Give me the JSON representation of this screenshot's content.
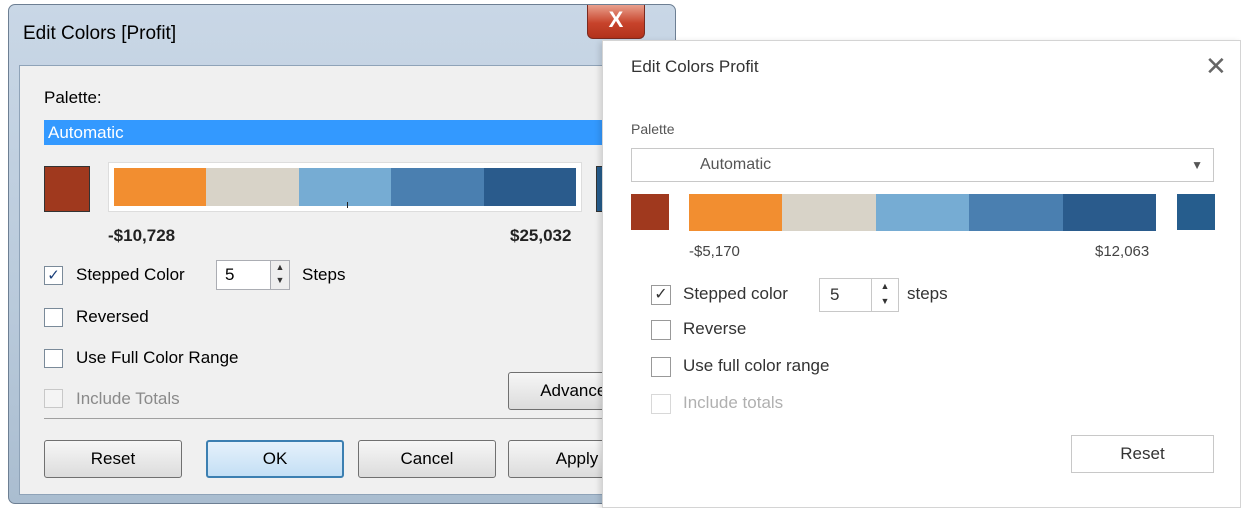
{
  "old_dialog": {
    "title": "Edit Colors [Profit]",
    "close_glyph": "X",
    "palette_label": "Palette:",
    "palette_value": "Automatic",
    "min_value": "-$10,728",
    "max_value": "$25,032",
    "stepped_label": "Stepped Color",
    "stepped_checked": "✓",
    "steps_value": "5",
    "steps_label": "Steps",
    "reversed_label": "Reversed",
    "full_range_label": "Use Full Color Range",
    "include_totals_label": "Include Totals",
    "advanced_label": "Advanced",
    "reset_label": "Reset",
    "ok_label": "OK",
    "cancel_label": "Cancel",
    "apply_label": "Apply",
    "colors": {
      "start": "#a0391e",
      "end": "#265d8d",
      "ramp": [
        "#f28e30",
        "#d8d3c8",
        "#76acd3",
        "#4a7fb0",
        "#2a5b8c"
      ]
    }
  },
  "new_dialog": {
    "title": "Edit Colors Profit",
    "close_glyph": "✕",
    "palette_label": "Palette",
    "palette_value": "Automatic",
    "palette_caret": "▼",
    "min_value": "-$5,170",
    "max_value": "$12,063",
    "stepped_label": "Stepped color",
    "stepped_checked": "✓",
    "steps_value": "5",
    "steps_label": "steps",
    "reverse_label": "Reverse",
    "full_range_label": "Use full color range",
    "include_totals_label": "Include totals",
    "reset_label": "Reset",
    "colors": {
      "start": "#a0391e",
      "end": "#265d8d",
      "ramp": [
        "#f28e30",
        "#d8d3c8",
        "#76acd3",
        "#4a7fb0",
        "#2a5b8c"
      ]
    }
  }
}
